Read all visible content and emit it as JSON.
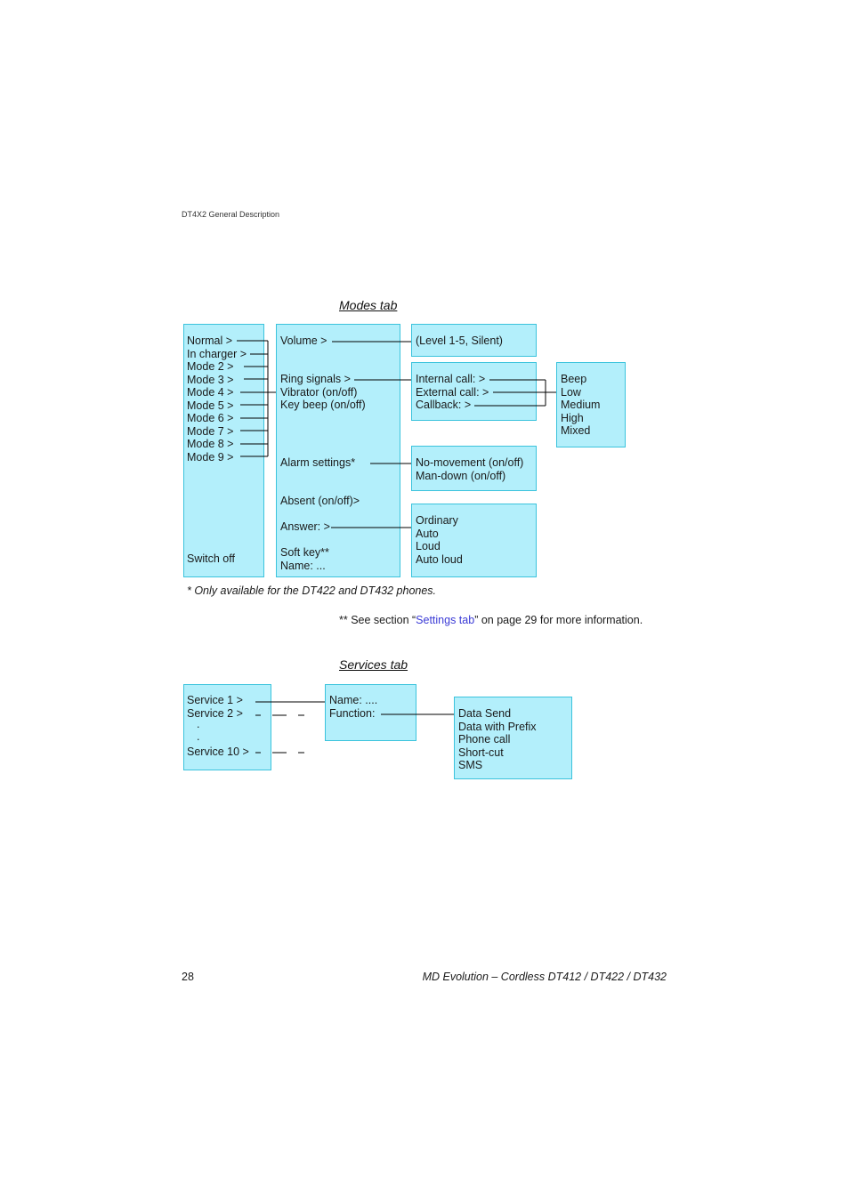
{
  "header": {
    "running_title": "DT4X2 General Description"
  },
  "modes": {
    "title": "Modes tab",
    "modes_list": [
      "Normal >",
      "In charger >",
      "Mode 2 >",
      "Mode 3 >",
      "Mode 4 >",
      "Mode 5 >",
      "Mode 6 >",
      "Mode 7 >",
      "Mode 8 >",
      "Mode 9 >"
    ],
    "switch_off": "Switch off",
    "settings": {
      "volume": "Volume >",
      "ring_signals": "Ring signals >",
      "vibrator": "Vibrator (on/off)",
      "key_beep": "Key beep (on/off)",
      "alarm_settings": "Alarm settings*",
      "absent": "Absent (on/off)>",
      "answer": "Answer: >",
      "soft_key": "Soft key**",
      "name": "Name: ..."
    },
    "volume_box": "(Level 1-5, Silent)",
    "ring_box": [
      "Internal call: >",
      "External call: >",
      "Callback: >"
    ],
    "ring_types": [
      "Beep",
      "Low",
      "Medium",
      "High",
      "Mixed"
    ],
    "alarm_box": [
      "No-movement (on/off)",
      "Man-down (on/off)"
    ],
    "answer_box": [
      "Ordinary",
      "Auto",
      "Loud",
      "Auto loud"
    ],
    "footnote1": "* Only available for the DT422 and DT432 phones.",
    "footnote2": {
      "prefix": "** See section “",
      "link": "Settings tab",
      "suffix": "” on page 29 for more information."
    }
  },
  "services": {
    "title": "Services tab",
    "list": [
      "Service 1 >",
      "Service 2 >",
      ".",
      ".",
      "Service 10 >"
    ],
    "detail": [
      "Name: ....",
      "Function:"
    ],
    "functions": [
      "Data Send",
      "Data with Prefix",
      "Phone call",
      "Short-cut",
      "SMS"
    ]
  },
  "footer": {
    "page_number": "28",
    "doc_title": "MD Evolution – Cordless DT412 / DT422 / DT432"
  }
}
